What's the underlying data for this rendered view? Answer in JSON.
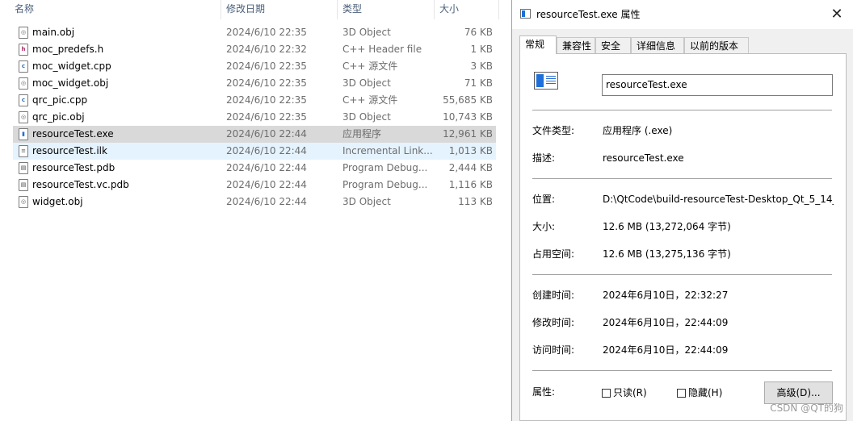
{
  "explorer": {
    "columns": {
      "name": "名称",
      "date": "修改日期",
      "type": "类型",
      "size": "大小"
    },
    "files": [
      {
        "name": "main.obj",
        "date": "2024/6/10 22:35",
        "type": "3D Object",
        "size": "76 KB",
        "icon": "obj-file-icon"
      },
      {
        "name": "moc_predefs.h",
        "date": "2024/6/10 22:32",
        "type": "C++ Header file",
        "size": "1 KB",
        "icon": "header-file-icon"
      },
      {
        "name": "moc_widget.cpp",
        "date": "2024/6/10 22:35",
        "type": "C++ 源文件",
        "size": "3 KB",
        "icon": "cpp-file-icon"
      },
      {
        "name": "moc_widget.obj",
        "date": "2024/6/10 22:35",
        "type": "3D Object",
        "size": "71 KB",
        "icon": "obj-file-icon"
      },
      {
        "name": "qrc_pic.cpp",
        "date": "2024/6/10 22:35",
        "type": "C++ 源文件",
        "size": "55,685 KB",
        "icon": "cpp-file-icon"
      },
      {
        "name": "qrc_pic.obj",
        "date": "2024/6/10 22:35",
        "type": "3D Object",
        "size": "10,743 KB",
        "icon": "obj-file-icon"
      },
      {
        "name": "resourceTest.exe",
        "date": "2024/6/10 22:44",
        "type": "应用程序",
        "size": "12,961 KB",
        "icon": "exe-file-icon",
        "state": "selected"
      },
      {
        "name": "resourceTest.ilk",
        "date": "2024/6/10 22:44",
        "type": "Incremental Link...",
        "size": "1,013 KB",
        "icon": "ilk-file-icon",
        "state": "hover"
      },
      {
        "name": "resourceTest.pdb",
        "date": "2024/6/10 22:44",
        "type": "Program Debug...",
        "size": "2,444 KB",
        "icon": "pdb-file-icon"
      },
      {
        "name": "resourceTest.vc.pdb",
        "date": "2024/6/10 22:44",
        "type": "Program Debug...",
        "size": "1,116 KB",
        "icon": "pdb-file-icon"
      },
      {
        "name": "widget.obj",
        "date": "2024/6/10 22:44",
        "type": "3D Object",
        "size": "113 KB",
        "icon": "obj-file-icon"
      }
    ]
  },
  "dialog": {
    "title": "resourceTest.exe 属性",
    "close_glyph": "✕",
    "tabs": [
      {
        "label": "常规",
        "active": true
      },
      {
        "label": "兼容性"
      },
      {
        "label": "安全"
      },
      {
        "label": "详细信息"
      },
      {
        "label": "以前的版本"
      }
    ],
    "filename": "resourceTest.exe",
    "fields": {
      "file_type": {
        "label": "文件类型:",
        "value": "应用程序 (.exe)"
      },
      "description": {
        "label": "描述:",
        "value": "resourceTest.exe"
      },
      "location": {
        "label": "位置:",
        "value": "D:\\QtCode\\build-resourceTest-Desktop_Qt_5_14_"
      },
      "size": {
        "label": "大小:",
        "value": "12.6 MB (13,272,064 字节)"
      },
      "size_on_disk": {
        "label": "占用空间:",
        "value": "12.6 MB (13,275,136 字节)"
      },
      "created": {
        "label": "创建时间:",
        "value": "2024年6月10日，22:32:27"
      },
      "modified": {
        "label": "修改时间:",
        "value": "2024年6月10日，22:44:09"
      },
      "accessed": {
        "label": "访问时间:",
        "value": "2024年6月10日，22:44:09"
      }
    },
    "attributes": {
      "label": "属性:",
      "readonly": {
        "label": "只读(R)",
        "checked": false
      },
      "hidden": {
        "label": "隐藏(H)",
        "checked": false
      },
      "advanced_button": "高级(D)..."
    }
  },
  "watermark": "CSDN @QT的狗"
}
